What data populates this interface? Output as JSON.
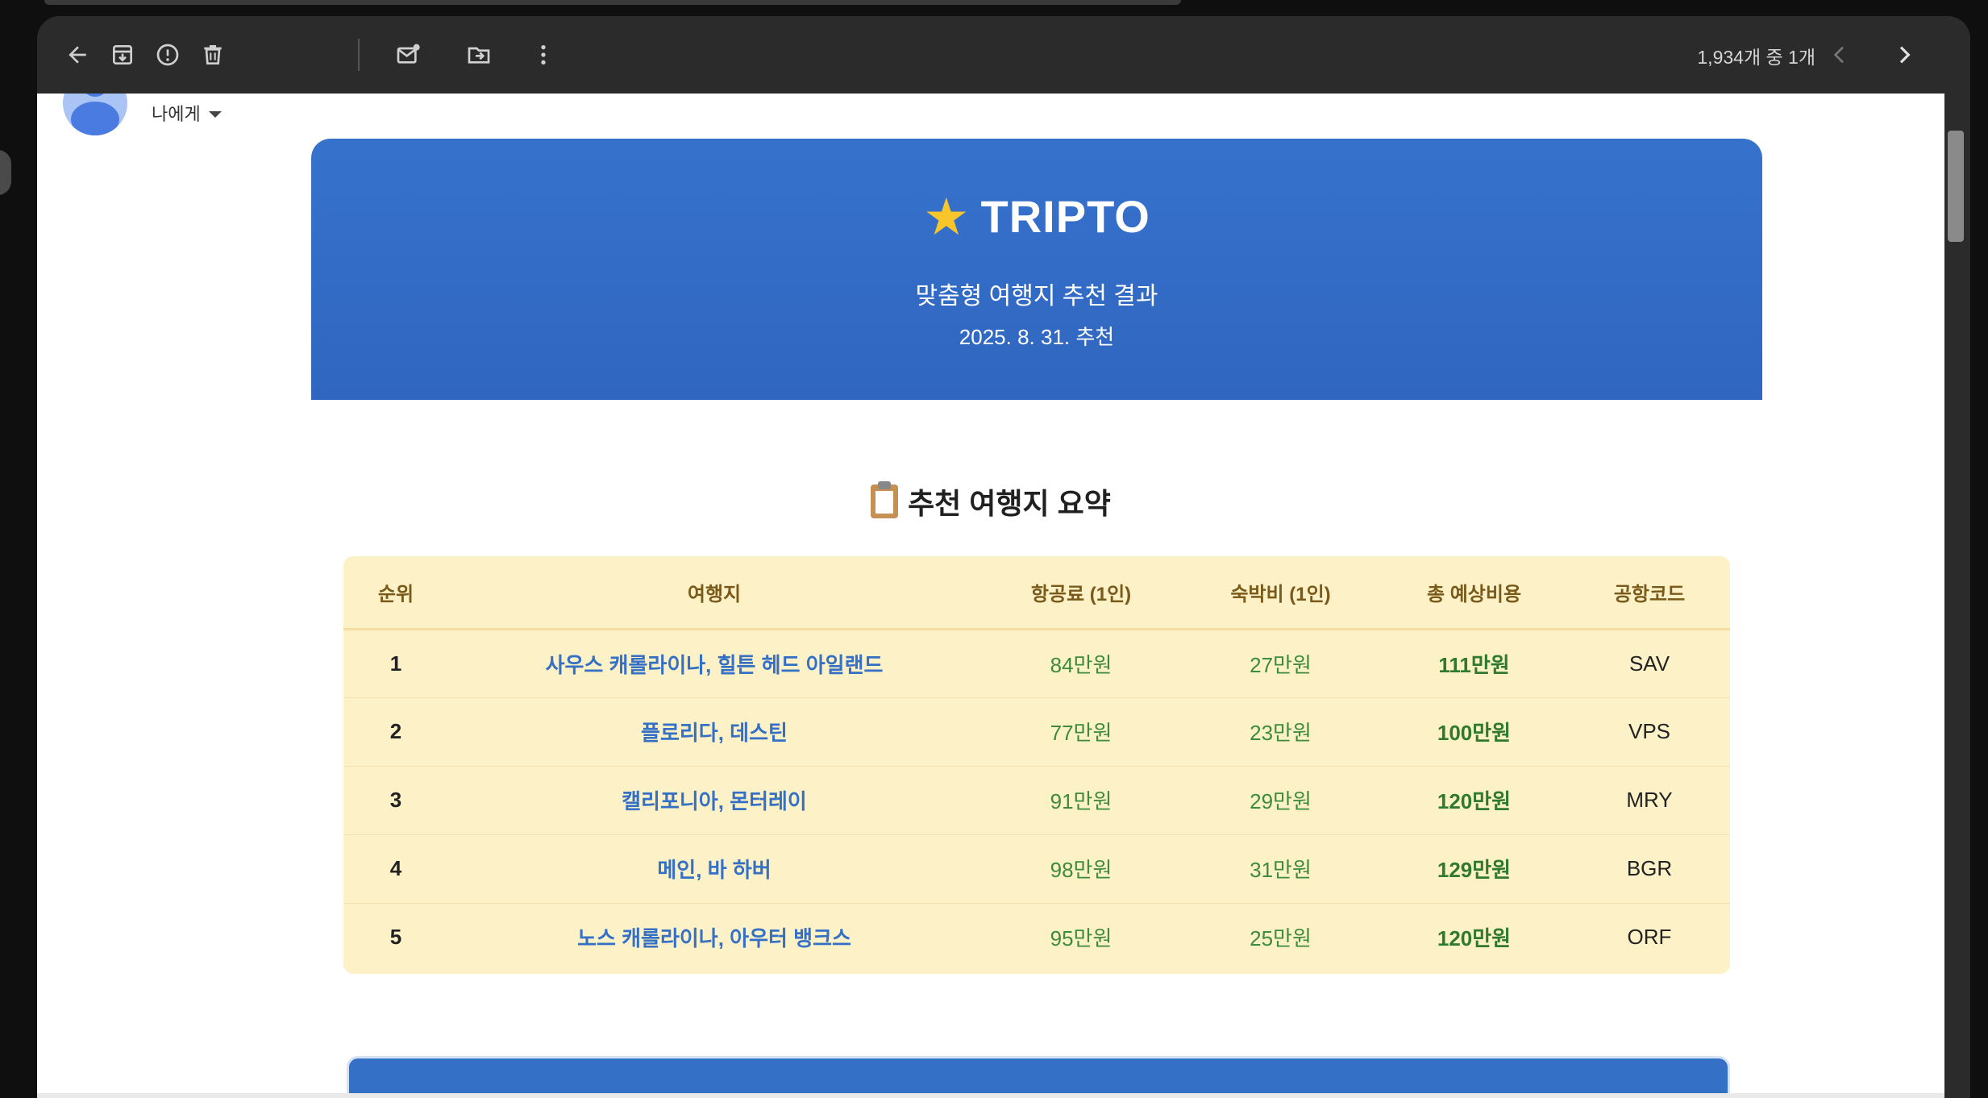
{
  "toolbar": {
    "icons": [
      "back-arrow-icon",
      "archive-icon",
      "report-spam-icon",
      "delete-icon",
      "mark-unread-icon",
      "move-to-icon",
      "more-vert-icon",
      "prev-icon",
      "next-icon"
    ],
    "count_text": "1,934개 중 1개"
  },
  "email": {
    "to_label": "나에게"
  },
  "hero": {
    "brand": "TRIPTO",
    "subtitle": "맞춤형 여행지 추천 결과",
    "date": "2025. 8. 31. 추천",
    "color": "#3270c8"
  },
  "summary": {
    "title": "추천 여행지 요약",
    "columns": [
      "순위",
      "여행지",
      "항공료 (1인)",
      "숙박비 (1인)",
      "총 예상비용",
      "공항코드"
    ],
    "rows": [
      {
        "rank": "1",
        "destination": "사우스 캐롤라이나, 힐튼 헤드 아일랜드",
        "airfare": "84만원",
        "lodging": "27만원",
        "total": "111만원",
        "code": "SAV"
      },
      {
        "rank": "2",
        "destination": "플로리다, 데스틴",
        "airfare": "77만원",
        "lodging": "23만원",
        "total": "100만원",
        "code": "VPS"
      },
      {
        "rank": "3",
        "destination": "캘리포니아, 몬터레이",
        "airfare": "91만원",
        "lodging": "29만원",
        "total": "120만원",
        "code": "MRY"
      },
      {
        "rank": "4",
        "destination": "메인, 바 하버",
        "airfare": "98만원",
        "lodging": "31만원",
        "total": "129만원",
        "code": "BGR"
      },
      {
        "rank": "5",
        "destination": "노스 캐롤라이나, 아우터 뱅크스",
        "airfare": "95만원",
        "lodging": "25만원",
        "total": "120만원",
        "code": "ORF"
      }
    ],
    "table_bg": "#fdf1c7"
  }
}
